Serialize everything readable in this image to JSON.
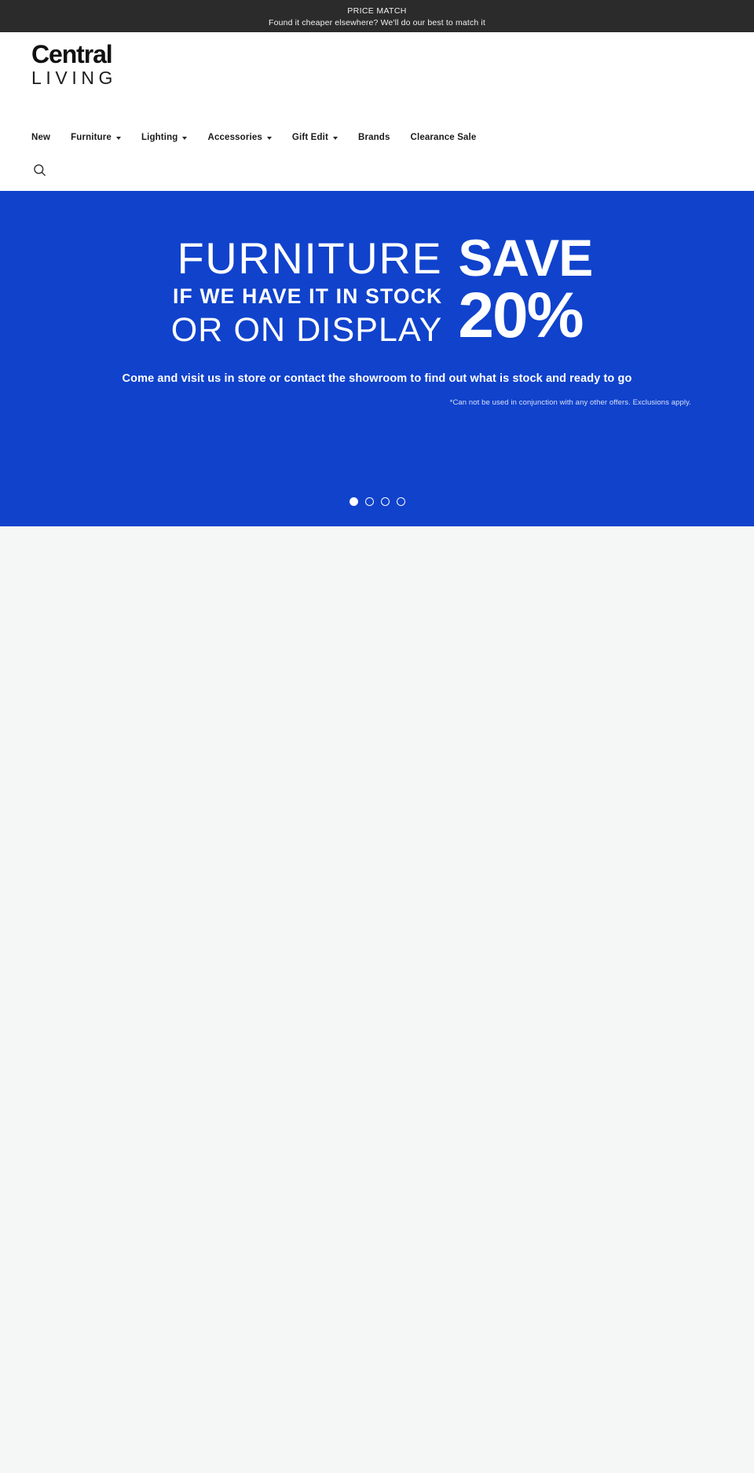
{
  "announcement": {
    "title": "PRICE MATCH",
    "subtitle": "Found it cheaper elsewhere? We'll do our best to match it",
    "background": "#2b2b2b"
  },
  "header": {
    "logo": {
      "line1": "Central",
      "line2": "LIVING"
    },
    "nav": [
      {
        "label": "New",
        "has_dropdown": false
      },
      {
        "label": "Furniture",
        "has_dropdown": true
      },
      {
        "label": "Lighting",
        "has_dropdown": true
      },
      {
        "label": "Accessories",
        "has_dropdown": true
      },
      {
        "label": "Gift Edit",
        "has_dropdown": true
      },
      {
        "label": "Brands",
        "has_dropdown": false
      },
      {
        "label": "Clearance Sale",
        "has_dropdown": false
      }
    ],
    "search_icon": "search-icon",
    "account_icon": "account-person-icon",
    "cart_icon": "shopping-cart-icon"
  },
  "hero": {
    "background": "#1042cc",
    "headline": {
      "line1": "FURNITURE",
      "line2": "IF WE HAVE IT IN STOCK",
      "line3": "OR ON DISPLAY",
      "promo_word": "SAVE",
      "promo_amount": "20%"
    },
    "subtitle": "Come and visit us in store or contact the showroom to find out what is stock and ready to go",
    "disclaimer": "*Can not be used in conjunction with any other offers. Exclusions apply.",
    "carousel": {
      "total_slides": 4,
      "active_slide": 1
    }
  },
  "colors": {
    "accent_blue": "#1042cc",
    "announcement_dark": "#2b2b2b",
    "page_background": "#f5f6f6",
    "text_dark": "#1a1a1a"
  }
}
